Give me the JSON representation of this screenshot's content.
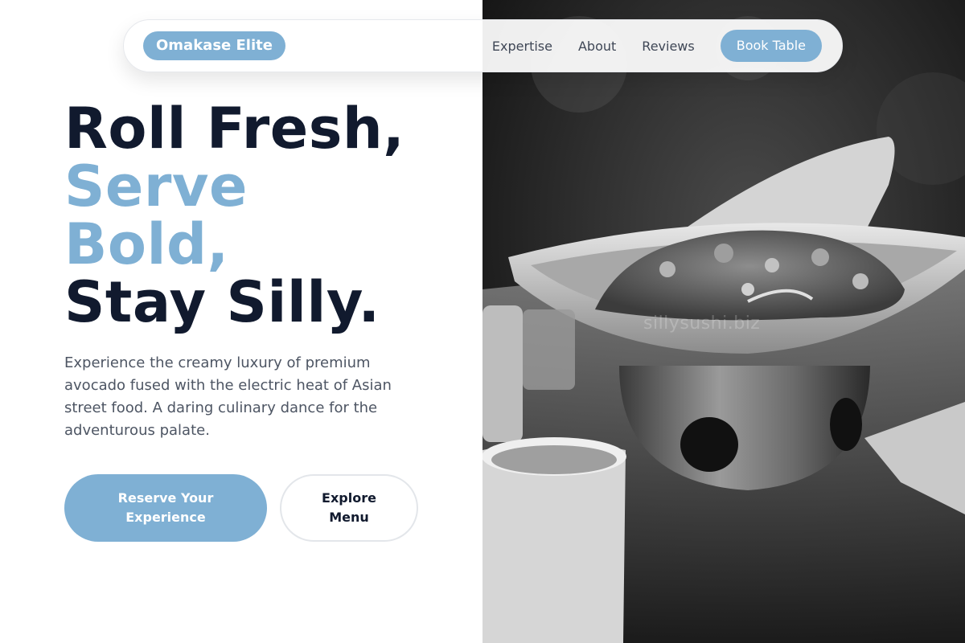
{
  "nav": {
    "brand": "Omakase Elite",
    "links": [
      "Expertise",
      "About",
      "Reviews"
    ],
    "cta": "Book Table"
  },
  "hero": {
    "headline": {
      "line1": "Roll Fresh,",
      "line2": "Serve",
      "line3": "Bold,",
      "line4": "Stay Silly."
    },
    "description": "Experience the creamy luxury of premium avocado fused with the electric heat of Asian street food. A daring culinary dance for the adventurous palate.",
    "primary_cta": "Reserve Your Experience",
    "secondary_cta": "Explore Menu"
  },
  "image": {
    "subject": "black-and-white photo of a sushi dish on a burner stand",
    "watermark": "sillysushi.biz"
  },
  "colors": {
    "accent": "#7fb0d4",
    "heading": "#111a2e",
    "body_text": "#4d5563",
    "nav_text": "#3f4756"
  }
}
